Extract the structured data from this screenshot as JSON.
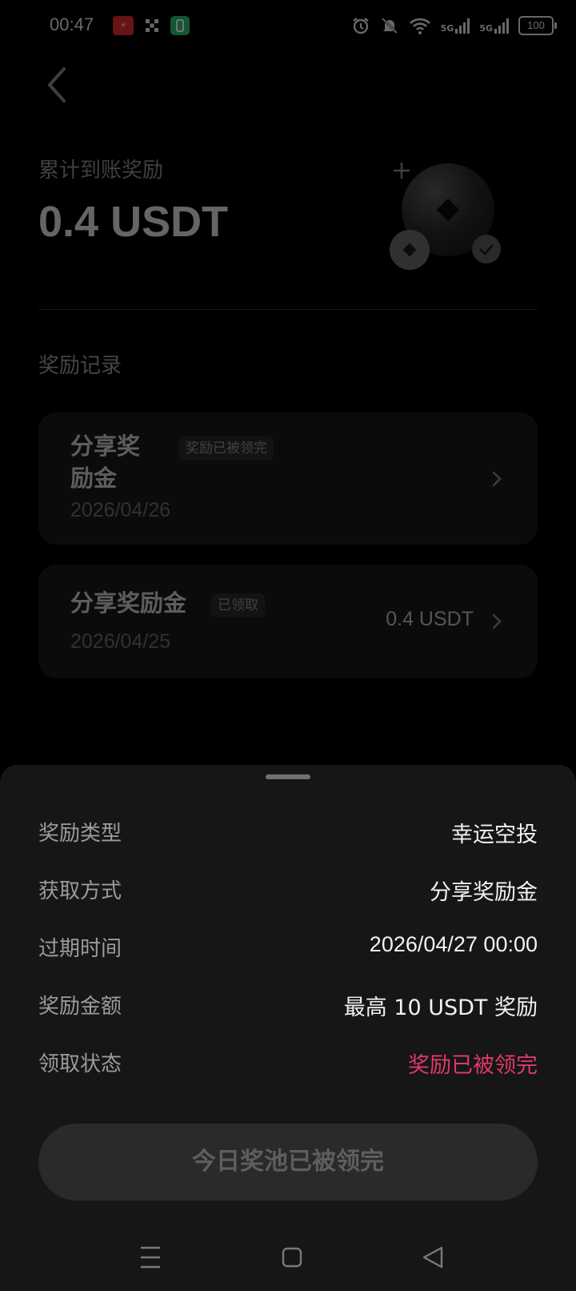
{
  "status_bar": {
    "time": "00:47",
    "app_icon_1": "lightning-app-icon",
    "app_icon_2": "x-app-icon",
    "app_icon_3": "green-app-icon",
    "alarm_icon": "alarm-icon",
    "mute_icon": "bell-off-icon",
    "wifi_icon": "wifi-icon",
    "signal_1": "5G",
    "signal_2": "5G",
    "battery": "100"
  },
  "header": {
    "back_icon": "chevron-left-icon",
    "total_label": "累计到账奖励",
    "total_value": "0.4 USDT"
  },
  "records": {
    "section_label": "奖励记录",
    "items": [
      {
        "title": "分享奖励金",
        "badge": "奖励已被领完",
        "date": "2026/04/26",
        "amount": ""
      },
      {
        "title": "分享奖励金",
        "badge": "已领取",
        "date": "2026/04/25",
        "amount": "0.4 USDT"
      }
    ]
  },
  "sheet": {
    "rows": [
      {
        "key": "奖励类型",
        "value": "幸运空投"
      },
      {
        "key": "获取方式",
        "value": "分享奖励金"
      },
      {
        "key": "过期时间",
        "value": "2026/04/27 00:00"
      },
      {
        "key": "奖励金额",
        "value": "最高 10 USDT 奖励"
      },
      {
        "key": "领取状态",
        "value": "奖励已被领完"
      }
    ],
    "button_label": "今日奖池已被领完"
  },
  "colors": {
    "status_alert": "#e0386a",
    "sheet_bg": "#161616",
    "card_bg": "#1a1a1a"
  },
  "navbar": {
    "menu_icon": "menu-icon",
    "home_icon": "home-square-icon",
    "back_icon": "back-triangle-icon"
  }
}
